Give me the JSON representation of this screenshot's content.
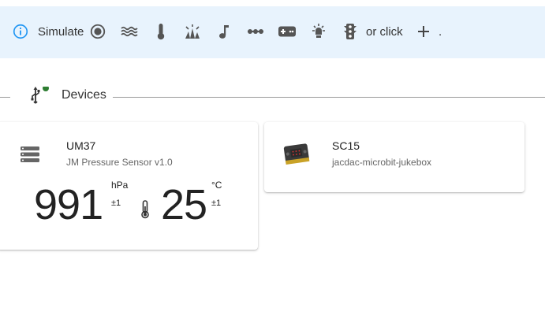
{
  "simulate_bar": {
    "info_icon": "info-icon",
    "label": "Simulate",
    "icons": [
      "record-circle-icon",
      "waves-icon",
      "thermometer-icon",
      "grass-sun-icon",
      "music-note-icon",
      "dots-line-icon",
      "gamepad-icon",
      "lightbulb-icon",
      "traffic-light-icon"
    ],
    "or_click": "or click",
    "add_icon": "plus-icon",
    "trailing": ".",
    "accent_color": "#2196f3",
    "background_color": "#e8f3fd"
  },
  "devices_section": {
    "title": "Devices",
    "icon": "usb-icon",
    "status_color": "#2e7d32"
  },
  "devices": [
    {
      "id": "UM37",
      "name": "JM Pressure Sensor v1.0",
      "icon": "stack-icon",
      "readings": [
        {
          "value": "991",
          "unit": "hPa",
          "error": "±1"
        },
        {
          "icon": "thermometer-icon",
          "value": "25",
          "unit": "°C",
          "error": "±1"
        }
      ]
    },
    {
      "id": "SC15",
      "name": "jacdac-microbit-jukebox",
      "icon": "microbit-board-icon"
    }
  ]
}
